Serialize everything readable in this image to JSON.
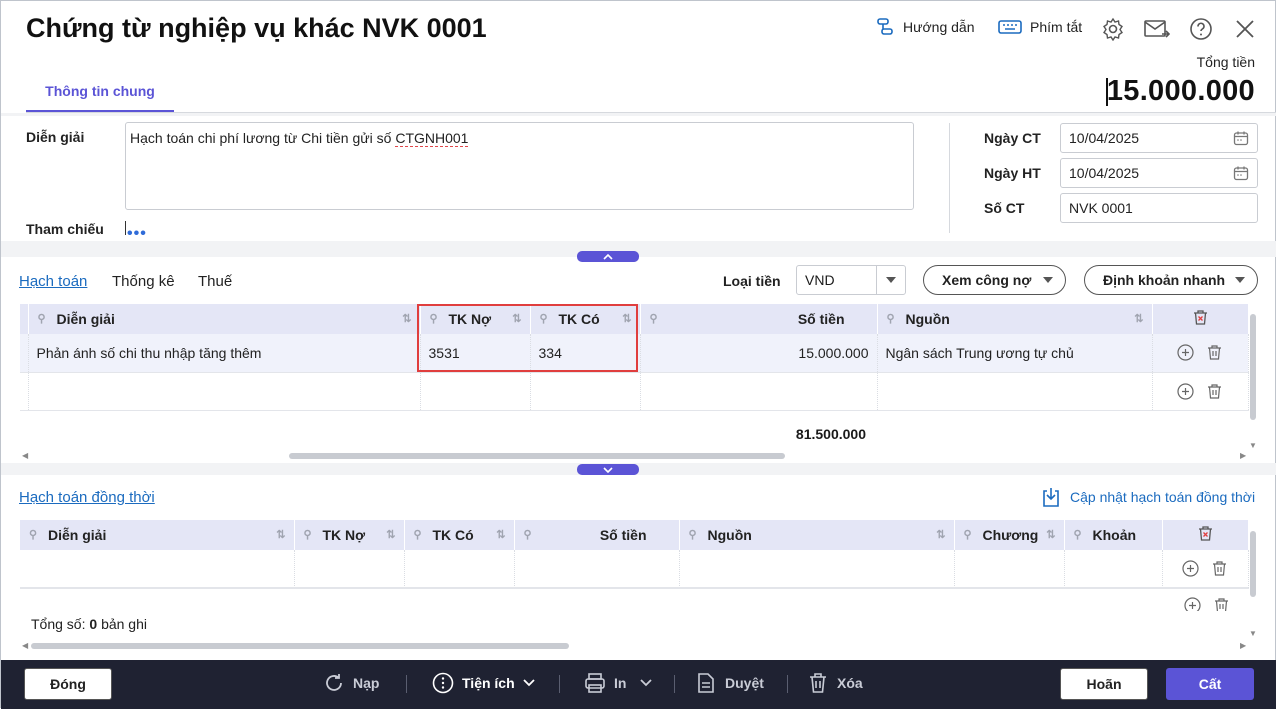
{
  "window": {
    "title": "Chứng từ nghiệp vụ khác NVK 0001",
    "guide_label": "Hướng dẫn",
    "shortcut_label": "Phím tắt",
    "total_label": "Tổng tiền",
    "total_value": "15.000.000"
  },
  "tabs": [
    {
      "label": "Thông tin chung"
    }
  ],
  "general": {
    "description_label": "Diễn giải",
    "description_text": "Hạch toán chi phí lương từ Chi tiền gửi số ",
    "description_ref": "CTGNH001",
    "reference_label": "Tham chiếu",
    "reference_more": "•••",
    "date_ct_label": "Ngày CT",
    "date_ct_value": "10/04/2025",
    "date_ht_label": "Ngày HT",
    "date_ht_value": "10/04/2025",
    "doc_no_label": "Số CT",
    "doc_no_value": "NVK 0001"
  },
  "posting": {
    "tabs": [
      "Hạch toán",
      "Thống kê",
      "Thuế"
    ],
    "currency_label": "Loại tiền",
    "currency_value": "VND",
    "debt_button": "Xem công nợ",
    "quick_button": "Định khoản nhanh",
    "columns": [
      "Diễn giải",
      "TK Nợ",
      "TK Có",
      "Số tiền",
      "Nguồn"
    ],
    "rows": [
      {
        "desc": "Phản ánh số chi thu nhập tăng thêm",
        "debit": "3531",
        "credit": "334",
        "amount": "15.000.000",
        "source": "Ngân sách Trung ương tự chủ"
      }
    ],
    "sum": "81.500.000"
  },
  "concurrent": {
    "title": "Hạch toán đồng thời",
    "update_label": "Cập nhật hạch toán đồng thời",
    "columns": [
      "Diễn giải",
      "TK Nợ",
      "TK Có",
      "Số tiền",
      "Nguồn",
      "Chương",
      "Khoản"
    ],
    "count_prefix": "Tổng số:",
    "count_value": "0",
    "count_suffix": "bản ghi"
  },
  "footer": {
    "close": "Đóng",
    "reload": "Nạp",
    "utilities": "Tiện ích",
    "print": "In",
    "approve": "Duyệt",
    "delete": "Xóa",
    "undo": "Hoãn",
    "save": "Cất"
  },
  "colors": {
    "accent": "#5b54d6",
    "link": "#1b6bbf",
    "footer": "#1f2232",
    "highlight": "#e03e3e"
  }
}
